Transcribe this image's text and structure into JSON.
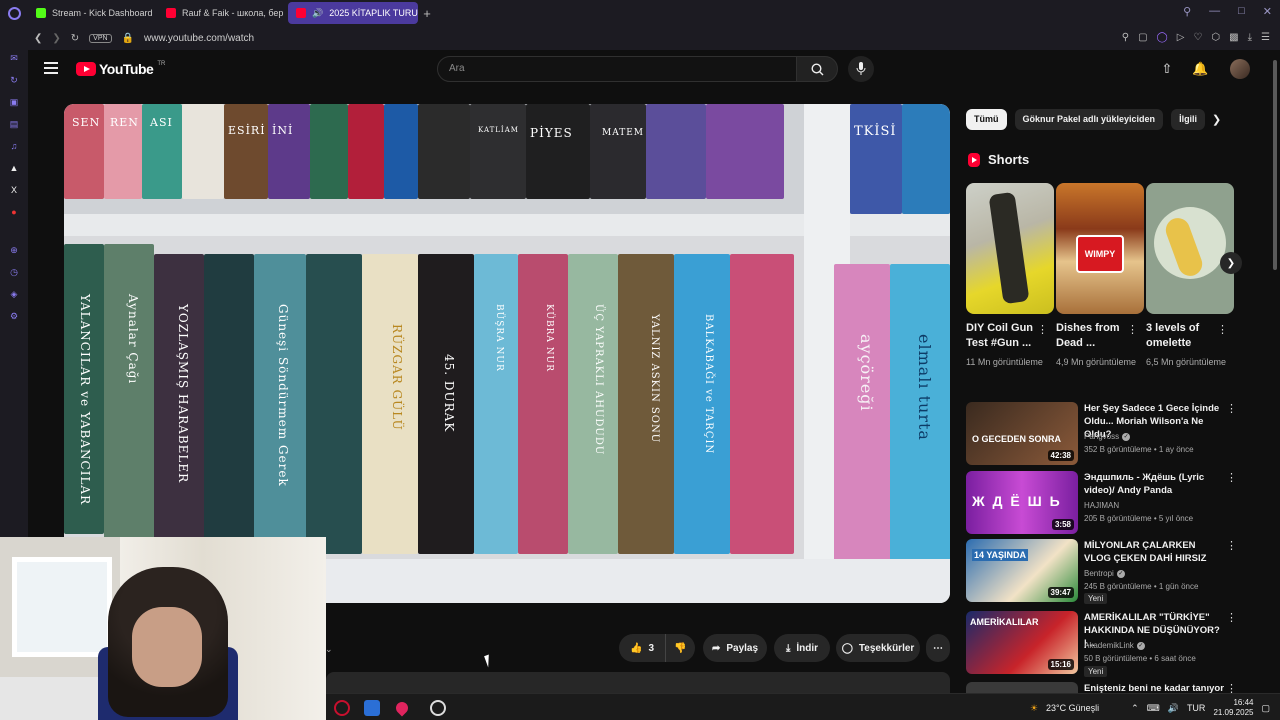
{
  "browser": {
    "tabs": [
      {
        "label": "Stream - Kick Dashboard",
        "color": "#53fc18"
      },
      {
        "label": "Rauf & Faik - школа, бер",
        "color": "#ff0033"
      },
      {
        "label": "2025 KİTAPLIK TURU",
        "color": "#ff0033"
      }
    ],
    "vpn_label": "VPN",
    "url": "www.youtube.com/watch"
  },
  "youtube": {
    "logo_text": "YouTube",
    "logo_region": "TR",
    "search_placeholder": "Ara"
  },
  "video": {
    "spines_top": [
      "SEN",
      "REN",
      "ASI",
      "ESİRİ",
      "İNİ",
      "KATLİAM",
      "PİYES",
      "MATEM",
      "TKİSİ"
    ],
    "spines_bottom": [
      "YALANCILAR ve YABANCILAR",
      "Aynalar Çağı",
      "YOZLAŞMIŞ HARABELER",
      "Güneşi Söndürmem Gerek",
      "RÜZGAR GÜLÜ",
      "45. DURAK",
      "BÜŞRA NUR",
      "KÜBRA NUR",
      "ÜÇ YAPRAKLI AHUDUDU",
      "YALNIZ ASKIN SONU",
      "BALKABAĞI ve TARÇIN",
      "ayçöreği",
      "elmalı turta"
    ]
  },
  "actions": {
    "like_count": "3",
    "share": "Paylaş",
    "download": "İndir",
    "thanks": "Teşekkürler"
  },
  "chips": [
    "Tümü",
    "Göknur Pakel adlı yükleyiciden",
    "İlgili"
  ],
  "shorts": {
    "title": "Shorts",
    "items": [
      {
        "title": "DIY Coil Gun Test #Gun ...",
        "views": "11 Mn görüntüleme"
      },
      {
        "title": "Dishes from Dead ...",
        "views": "4,9 Mn görüntüleme"
      },
      {
        "title": "3 levels of omelette",
        "views": "6,5 Mn görüntüleme"
      }
    ],
    "thumb2_text": "WIMPY"
  },
  "recommendations": [
    {
      "title": "Her Şey Sadece 1 Gece İçinde Oldu... Moriah Wilson'a Ne Oldu?",
      "channel": "Pangvoss",
      "stats": "352 B görüntüleme • 1 ay önce",
      "duration": "42:38",
      "thumb_text": "O GECEDEN SONRA",
      "new": ""
    },
    {
      "title": "Эндшпиль - Ждёшь (Lyric video)/ Andy Panda",
      "channel": "HAJIMAN",
      "stats": "205 B görüntüleme • 5 yıl önce",
      "duration": "3:58",
      "thumb_text": "Ж Д Ё Ш Ь",
      "new": ""
    },
    {
      "title": "MİLYONLAR ÇALARKEN VLOG ÇEKEN DAHİ HIRSIZ",
      "channel": "Bentropi",
      "stats": "245 B görüntüleme • 1 gün önce",
      "duration": "39:47",
      "thumb_text": "14 YAŞINDA",
      "new": "Yeni"
    },
    {
      "title": "AMERİKALILAR \"TÜRKİYE\" HAKKINDA NE DÜŞÜNÜYOR? |...",
      "channel": "AkademikLink",
      "stats": "50 B görüntüleme • 6 saat önce",
      "duration": "15:16",
      "thumb_text": "AMERİKALILAR",
      "new": "Yeni"
    },
    {
      "title": "Enişteniz beni ne kadar tanıyor",
      "channel": "",
      "stats": "",
      "duration": "",
      "thumb_text": "",
      "new": ""
    }
  ],
  "taskbar": {
    "weather": "23°C  Güneşli",
    "lang": "TUR",
    "time": "16:44",
    "date": "21.09.2025"
  }
}
